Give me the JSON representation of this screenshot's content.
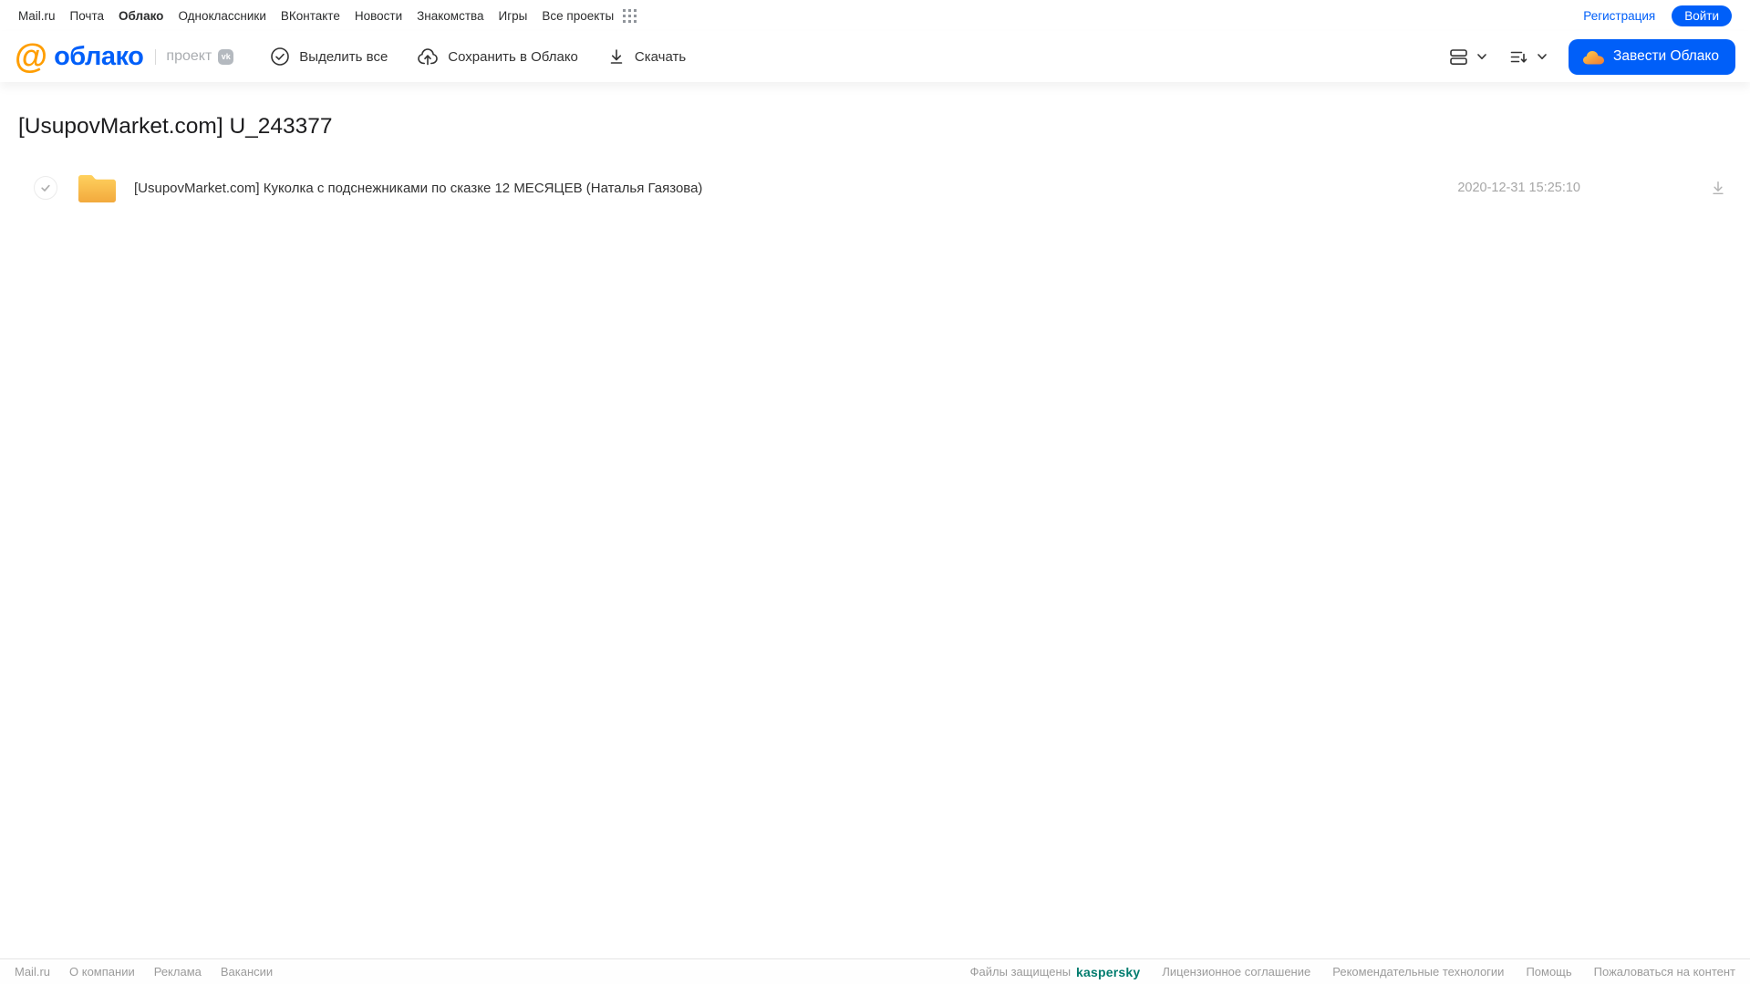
{
  "portal_nav": {
    "links": [
      {
        "label": "Mail.ru"
      },
      {
        "label": "Почта"
      },
      {
        "label": "Облако"
      },
      {
        "label": "Одноклассники"
      },
      {
        "label": "ВКонтакте"
      },
      {
        "label": "Новости"
      },
      {
        "label": "Знакомства"
      },
      {
        "label": "Игры"
      },
      {
        "label": "Все проекты"
      }
    ],
    "registration_label": "Регистрация",
    "login_label": "Войти"
  },
  "header": {
    "logo_text": "облако",
    "logo_at": "@",
    "project_label": "проект",
    "vk_badge_label": "vk",
    "actions": {
      "select_all": "Выделить все",
      "save_to_cloud": "Сохранить в Облако",
      "download": "Скачать"
    },
    "create_cloud_label": "Завести Облако"
  },
  "main": {
    "title": "[UsupovMarket.com] U_243377",
    "files": [
      {
        "type": "folder",
        "name": "[UsupovMarket.com] Куколка с подснежниками по сказке 12 МЕСЯЦЕВ (Наталья Гаязова)",
        "date": "2020-12-31 15:25:10"
      }
    ]
  },
  "footer": {
    "left_links": [
      "Mail.ru",
      "О компании",
      "Реклама",
      "Вакансии"
    ],
    "protected_label": "Файлы защищены",
    "kaspersky_label": "kaspersky",
    "right_links": [
      "Лицензионное соглашение",
      "Рекомендательные технологии",
      "Помощь",
      "Пожаловаться на контент"
    ]
  },
  "colors": {
    "accent_blue": "#005ff9",
    "logo_orange": "#ff9e00",
    "folder_gradient_top": "#ffd15e",
    "folder_gradient_bottom": "#f2a93d",
    "kaspersky_green": "#007c6e",
    "muted_text": "#a6a6a6"
  }
}
